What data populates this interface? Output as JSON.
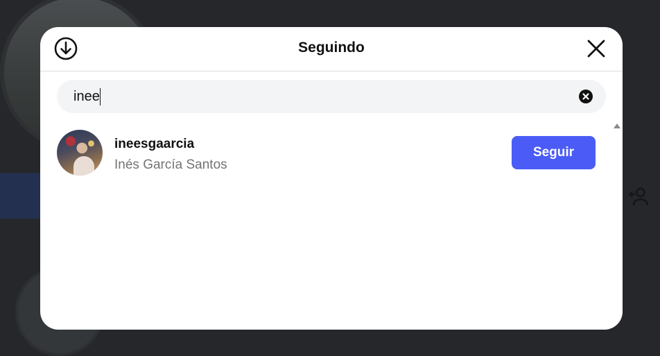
{
  "modal": {
    "title": "Seguindo",
    "icons": {
      "download": "download-circle-icon",
      "close": "close-icon",
      "clear": "clear-search-icon"
    }
  },
  "search": {
    "value": "inee"
  },
  "results": [
    {
      "username": "ineesgaarcia",
      "full_name": "Inés García Santos",
      "action_label": "Seguir"
    }
  ],
  "colors": {
    "accent": "#4a5cf5",
    "overlay": "#25272b",
    "secondary_text": "#737373"
  }
}
